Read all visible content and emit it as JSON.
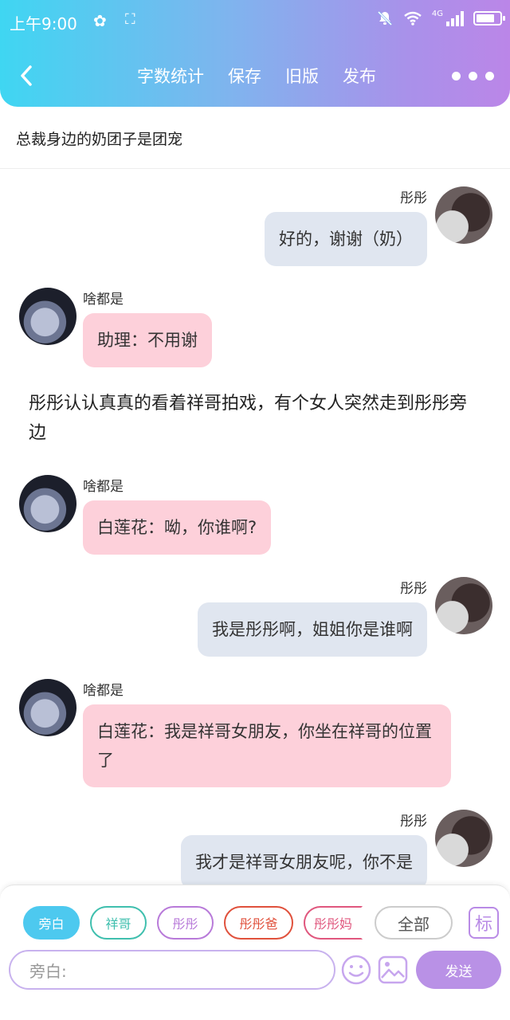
{
  "status_bar": {
    "time": "上午9:00",
    "network": "4G"
  },
  "toolbar": {
    "word_count": "字数统计",
    "save": "保存",
    "old_version": "旧版",
    "publish": "发布"
  },
  "document": {
    "title": "总裁身边的奶团子是团宠"
  },
  "messages": [
    {
      "speaker": "彤彤",
      "text": "好的，谢谢（奶）"
    },
    {
      "speaker": "啥都是",
      "text": "助理：不用谢"
    },
    {
      "narration": "彤彤认认真真的看着祥哥拍戏，有个女人突然走到彤彤旁边"
    },
    {
      "speaker": "啥都是",
      "text": "白莲花：呦，你谁啊?"
    },
    {
      "speaker": "彤彤",
      "text": "我是彤彤啊，姐姐你是谁啊"
    },
    {
      "speaker": "啥都是",
      "text": "白莲花：我是祥哥女朋友，你坐在祥哥的位置了"
    },
    {
      "speaker": "彤彤",
      "text": "我才是祥哥女朋友呢，你不是"
    }
  ],
  "roles": [
    "旁白",
    "祥哥",
    "彤彤",
    "彤彤爸",
    "彤彤妈",
    "全部"
  ],
  "role_colors": [
    "#4dc9ef",
    "#3fbfae",
    "#b87ad9",
    "#e0513c",
    "#e0577e",
    "#cccccc"
  ],
  "mark_button": "标",
  "composer": {
    "placeholder": "旁白:",
    "send": "发送"
  }
}
